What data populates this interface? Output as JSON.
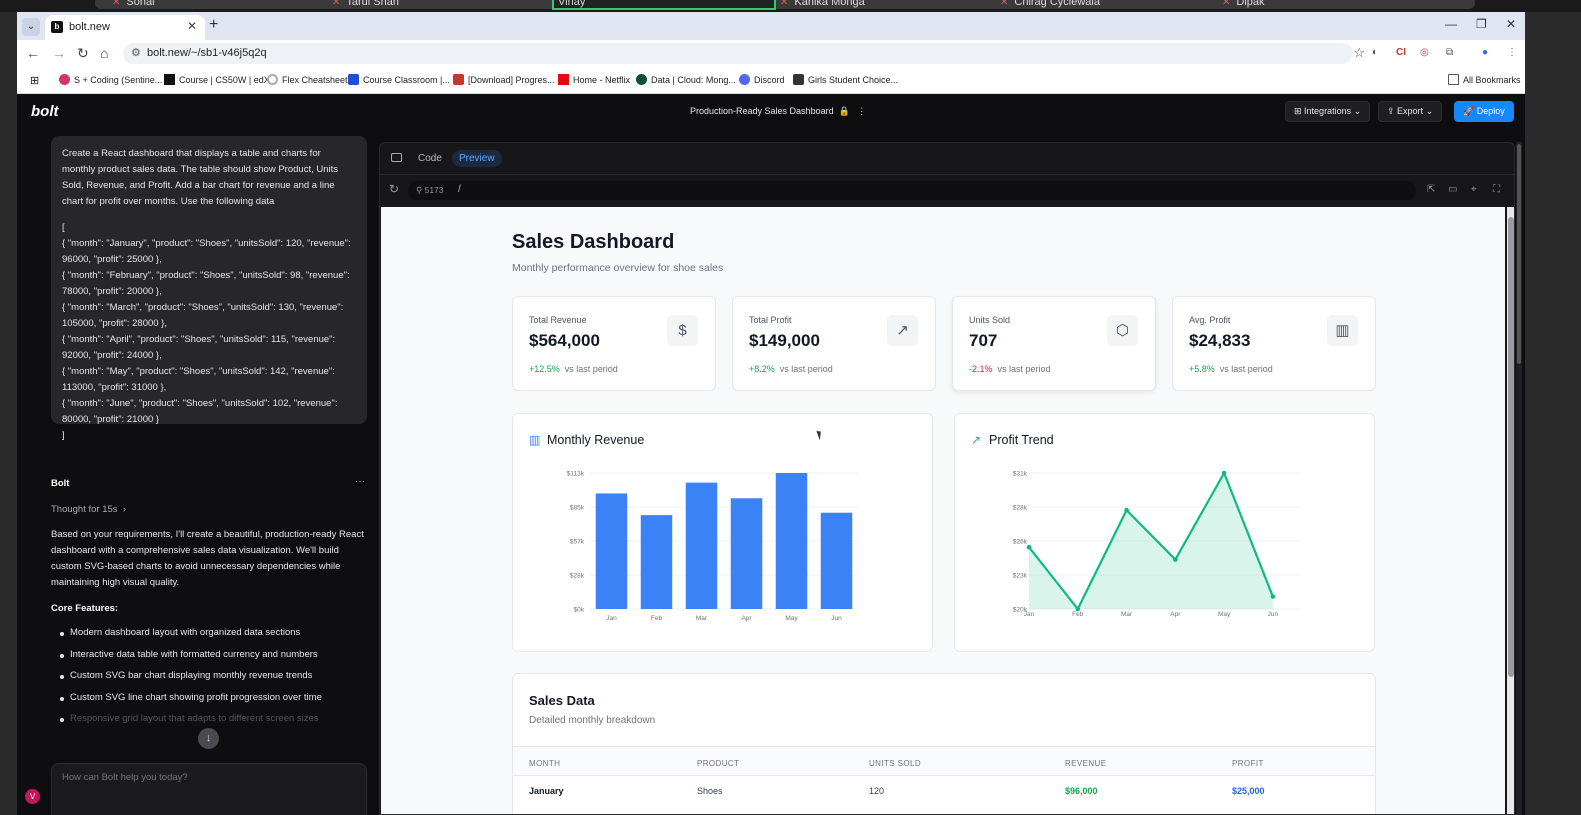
{
  "meeting": {
    "names": [
      "Sonal",
      "Tarul Shah",
      "Vinay",
      "Kanika Monga",
      "Chirag Cyclewala",
      "Dipak"
    ]
  },
  "browser": {
    "tab_title": "bolt.new",
    "url": "bolt.new/~/sb1-v46j5q2q",
    "bookmarks": [
      "S + Coding (Sentine...",
      "Course | CS50W | edX",
      "Flex Cheatsheet",
      "Course Classroom |...",
      "[Download] Progres...",
      "Home - Netflix",
      "Data | Cloud: Mong...",
      "Discord",
      "Girls Student Choice..."
    ],
    "all_bookmarks": "All Bookmarks",
    "colors": {
      "tabstrip": "#dfe6f2",
      "page": "#ffffff"
    }
  },
  "app": {
    "logo": "bolt",
    "project_title": "Production-Ready Sales Dashboard",
    "integrations_label": "Integrations",
    "export_label": "Export",
    "deploy_label": "Deploy",
    "accent": "#1488fc"
  },
  "chat": {
    "prompt_text": "Create a React dashboard that displays a table and charts for monthly product sales data. The table should show Product, Units Sold, Revenue, and Profit. Add a bar chart for revenue and a line chart for profit over months. Use the following data",
    "prompt_code": "[\n{ \"month\": \"January\", \"product\": \"Shoes\", \"unitsSold\": 120, \"revenue\": 96000, \"profit\": 25000 },\n{ \"month\": \"February\", \"product\": \"Shoes\", \"unitsSold\": 98, \"revenue\": 78000, \"profit\": 20000 },\n{ \"month\": \"March\", \"product\": \"Shoes\", \"unitsSold\": 130, \"revenue\": 105000, \"profit\": 28000 },\n{ \"month\": \"April\", \"product\": \"Shoes\", \"unitsSold\": 115, \"revenue\": 92000, \"profit\": 24000 },\n{ \"month\": \"May\", \"product\": \"Shoes\", \"unitsSold\": 142, \"revenue\": 113000, \"profit\": 31000 },\n{ \"month\": \"June\", \"product\": \"Shoes\", \"unitsSold\": 102, \"revenue\": 80000, \"profit\": 21000 }\n]",
    "bot_name": "Bolt",
    "thought": "Thought for 15s",
    "response": "Based on your requirements, I'll create a beautiful, production-ready React dashboard with a comprehensive sales data visualization. We'll build custom SVG-based charts to avoid unnecessary dependencies while maintaining high visual quality.",
    "features_heading": "Core Features:",
    "features": [
      "Modern dashboard layout with organized data sections",
      "Interactive data table with formatted currency and numbers",
      "Custom SVG bar chart displaying monthly revenue trends",
      "Custom SVG line chart showing profit progression over time",
      "Responsive grid layout that adapts to different screen sizes"
    ],
    "input_placeholder": "How can Bolt help you today?",
    "avatar_letter": "V"
  },
  "workbench": {
    "code_tab": "Code",
    "preview_tab": "Preview",
    "port": "5173",
    "path": "/"
  },
  "dashboard": {
    "title": "Sales Dashboard",
    "subtitle": "Monthly performance overview for shoe sales",
    "cards": [
      {
        "label": "Total Revenue",
        "value": "$564,000",
        "change": "+12.5%",
        "vs": "vs last period",
        "icon": "dollar-icon",
        "glyph": "$",
        "dir": "up"
      },
      {
        "label": "Total Profit",
        "value": "$149,000",
        "change": "+8.2%",
        "vs": "vs last period",
        "icon": "trending-up-icon",
        "glyph": "↗",
        "dir": "up"
      },
      {
        "label": "Units Sold",
        "value": "707",
        "change": "-2.1%",
        "vs": "vs last period",
        "icon": "package-icon",
        "glyph": "⬡",
        "dir": "down"
      },
      {
        "label": "Avg. Profit",
        "value": "$24,833",
        "change": "+5.8%",
        "vs": "vs last period",
        "icon": "bar-chart-icon",
        "glyph": "▥",
        "dir": "up"
      }
    ],
    "revenue_title": "Monthly Revenue",
    "profit_title": "Profit Trend",
    "table_title": "Sales Data",
    "table_subtitle": "Detailed monthly breakdown",
    "columns": [
      "MONTH",
      "PRODUCT",
      "UNITS SOLD",
      "REVENUE",
      "PROFIT"
    ],
    "rows": [
      [
        "January",
        "Shoes",
        "120",
        "$96,000",
        "$25,000"
      ]
    ],
    "colors": {
      "bar": "#3b82f6",
      "line": "#10b981",
      "revenue_text": "#16a34a",
      "profit_text": "#2563eb"
    }
  },
  "chart_data": [
    {
      "type": "bar",
      "title": "Monthly Revenue",
      "categories": [
        "Jan",
        "Feb",
        "Mar",
        "Apr",
        "May",
        "Jun"
      ],
      "values": [
        96000,
        78000,
        105000,
        92000,
        113000,
        80000
      ],
      "yticks": [
        "$0k",
        "$28k",
        "$57k",
        "$85k",
        "$113k"
      ],
      "ylim": [
        0,
        113000
      ],
      "grid": true,
      "color": "#3b82f6"
    },
    {
      "type": "area",
      "title": "Profit Trend",
      "categories": [
        "Jan",
        "Feb",
        "Mar",
        "Apr",
        "May",
        "Jun"
      ],
      "values": [
        25000,
        20000,
        28000,
        24000,
        31000,
        21000
      ],
      "yticks": [
        "$20k",
        "$23k",
        "$26k",
        "$28k",
        "$31k"
      ],
      "ylim": [
        20000,
        31000
      ],
      "grid": true,
      "color": "#10b981"
    }
  ]
}
